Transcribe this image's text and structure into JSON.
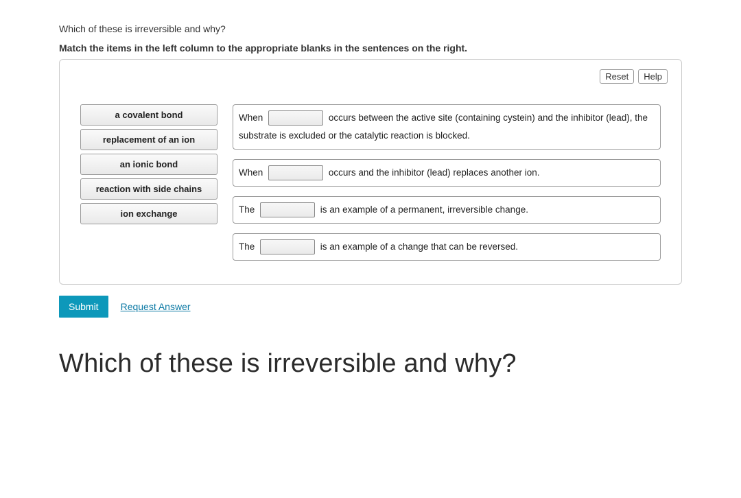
{
  "question": "Which of these is irreversible and why?",
  "instructions": "Match the items in the left column to the appropriate blanks in the sentences on the right.",
  "toolbar": {
    "reset": "Reset",
    "help": "Help"
  },
  "drag_items": [
    "a covalent bond",
    "replacement of an ion",
    "an ionic bond",
    "reaction with side chains",
    "ion exchange"
  ],
  "sentences": {
    "s1_a": "When",
    "s1_b": "occurs between the active site (containing cystein) and the inhibitor (lead), the substrate is excluded or the catalytic reaction is blocked.",
    "s2_a": "When",
    "s2_b": "occurs and the inhibitor (lead) replaces another ion.",
    "s3_a": "The",
    "s3_b": "is an example of a permanent, irreversible change.",
    "s4_a": "The",
    "s4_b": "is an example of a change that can be reversed."
  },
  "submit": "Submit",
  "request": "Request Answer",
  "heading": "Which of these is irreversible and why?"
}
